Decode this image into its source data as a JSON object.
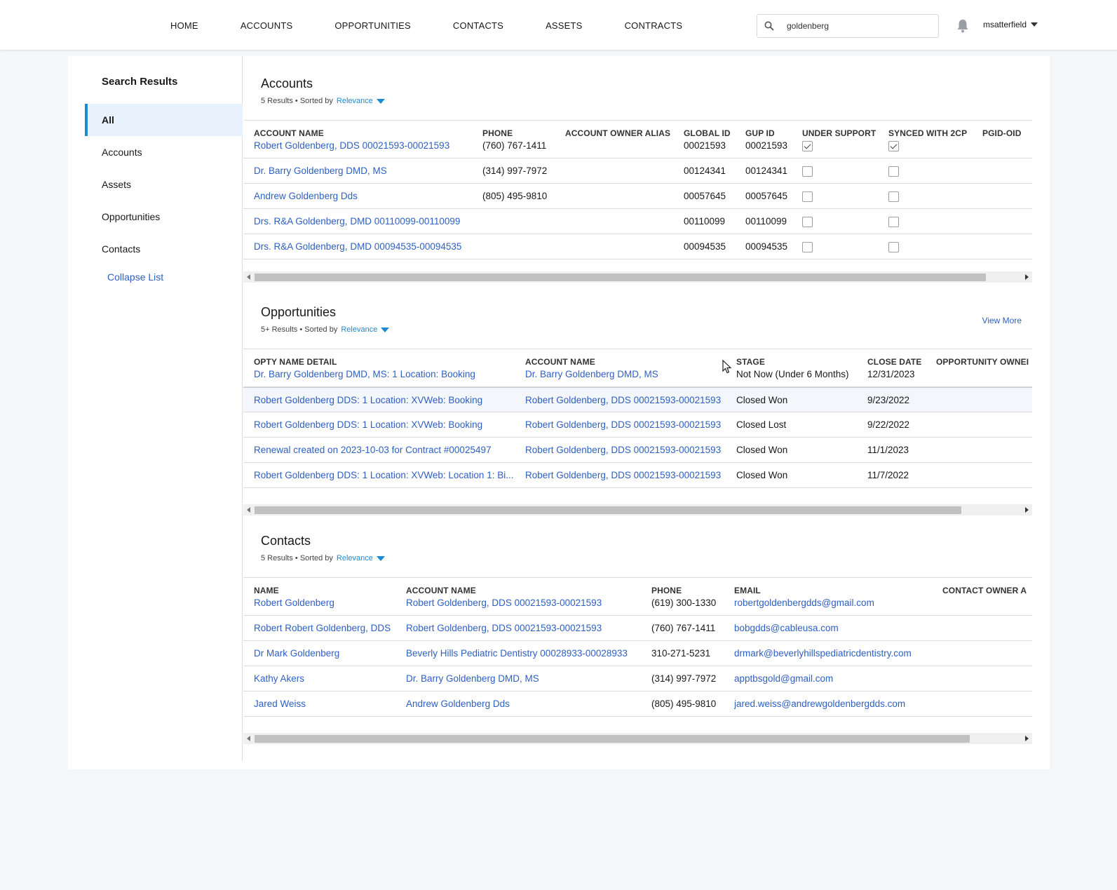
{
  "nav": {
    "items": [
      "HOME",
      "ACCOUNTS",
      "OPPORTUNITIES",
      "CONTACTS",
      "ASSETS",
      "CONTRACTS"
    ],
    "search_value": "goldenberg",
    "user": "msatterfield"
  },
  "sidebar": {
    "title": "Search Results",
    "items": [
      "All",
      "Accounts",
      "Assets",
      "Opportunities",
      "Contacts"
    ],
    "active": "All",
    "collapse": "Collapse List"
  },
  "accounts": {
    "title": "Accounts",
    "count": "5 Results",
    "sorted_by": "• Sorted by",
    "sort": "Relevance",
    "columns": [
      "ACCOUNT NAME",
      "PHONE",
      "ACCOUNT OWNER ALIAS",
      "GLOBAL ID",
      "GUP ID",
      "UNDER SUPPORT",
      "SYNCED WITH 2CP",
      "PGID-OID"
    ],
    "rows": [
      {
        "name": "Robert Goldenberg, DDS 00021593-00021593",
        "phone": "(760) 767-1411",
        "alias": "",
        "global_id": "00021593",
        "gup_id": "00021593",
        "under_support": true,
        "synced": true
      },
      {
        "name": "Dr. Barry Goldenberg DMD, MS",
        "phone": "(314) 997-7972",
        "alias": "",
        "global_id": "00124341",
        "gup_id": "00124341",
        "under_support": false,
        "synced": false
      },
      {
        "name": "Andrew Goldenberg Dds",
        "phone": "(805) 495-9810",
        "alias": "",
        "global_id": "00057645",
        "gup_id": "00057645",
        "under_support": false,
        "synced": false
      },
      {
        "name": "Drs. R&A Goldenberg, DMD 00110099-00110099",
        "phone": "",
        "alias": "",
        "global_id": "00110099",
        "gup_id": "00110099",
        "under_support": false,
        "synced": false
      },
      {
        "name": "Drs. R&A Goldenberg, DMD 00094535-00094535",
        "phone": "",
        "alias": "",
        "global_id": "00094535",
        "gup_id": "00094535",
        "under_support": false,
        "synced": false
      }
    ]
  },
  "opportunities": {
    "title": "Opportunities",
    "count": "5+ Results",
    "sorted_by": "• Sorted by",
    "sort": "Relevance",
    "view_more": "View More",
    "columns": [
      "OPTY NAME DETAIL",
      "ACCOUNT NAME",
      "STAGE",
      "CLOSE DATE",
      "OPPORTUNITY OWNEI"
    ],
    "rows": [
      {
        "opty": "Dr. Barry Goldenberg DMD, MS: 1 Location: Booking",
        "account": "Dr. Barry Goldenberg DMD, MS",
        "stage": "Not Now (Under 6 Months)",
        "close": "12/31/2023"
      },
      {
        "opty": "Robert Goldenberg DDS: 1 Location: XVWeb: Booking",
        "account": "Robert Goldenberg, DDS 00021593-00021593",
        "stage": "Closed Won",
        "close": "9/23/2022"
      },
      {
        "opty": "Robert Goldenberg DDS: 1 Location: XVWeb: Booking",
        "account": "Robert Goldenberg, DDS 00021593-00021593",
        "stage": "Closed Lost",
        "close": "9/22/2022"
      },
      {
        "opty": "Renewal created on 2023-10-03 for Contract #00025497",
        "account": "Robert Goldenberg, DDS 00021593-00021593",
        "stage": "Closed Won",
        "close": "11/1/2023"
      },
      {
        "opty": "Robert Goldenberg DDS: 1 Location: XVWeb: Location 1: Bi...",
        "account": "Robert Goldenberg, DDS 00021593-00021593",
        "stage": "Closed Won",
        "close": "11/7/2022"
      }
    ]
  },
  "contacts": {
    "title": "Contacts",
    "count": "5 Results",
    "sorted_by": "• Sorted by",
    "sort": "Relevance",
    "columns": [
      "NAME",
      "ACCOUNT NAME",
      "PHONE",
      "EMAIL",
      "CONTACT OWNER A"
    ],
    "rows": [
      {
        "name": "Robert Goldenberg",
        "account": "Robert Goldenberg, DDS 00021593-00021593",
        "phone": "(619) 300-1330",
        "email": "robertgoldenbergdds@gmail.com"
      },
      {
        "name": "Robert Robert Goldenberg, DDS",
        "account": "Robert Goldenberg, DDS 00021593-00021593",
        "phone": "(760) 767-1411",
        "email": "bobgdds@cableusa.com"
      },
      {
        "name": "Dr Mark Goldenberg",
        "account": "Beverly Hills Pediatric Dentistry 00028933-00028933",
        "phone": "310-271-5231",
        "email": "drmark@beverlyhillspediatricdentistry.com"
      },
      {
        "name": "Kathy Akers",
        "account": "Dr. Barry Goldenberg DMD, MS",
        "phone": "(314) 997-7972",
        "email": "apptbsgold@gmail.com"
      },
      {
        "name": "Jared Weiss",
        "account": "Andrew Goldenberg Dds",
        "phone": "(805) 495-9810",
        "email": "jared.weiss@andrewgoldenbergdds.com"
      }
    ]
  },
  "icons": {
    "search": "search-icon",
    "bell": "bell-icon",
    "user_menu": "chevron-down-icon",
    "cursor": "mouse-pointer-icon"
  },
  "colors": {
    "link": "#2e5fc2",
    "accent": "#1b8ad2",
    "active_bg": "#e8f2fd"
  }
}
